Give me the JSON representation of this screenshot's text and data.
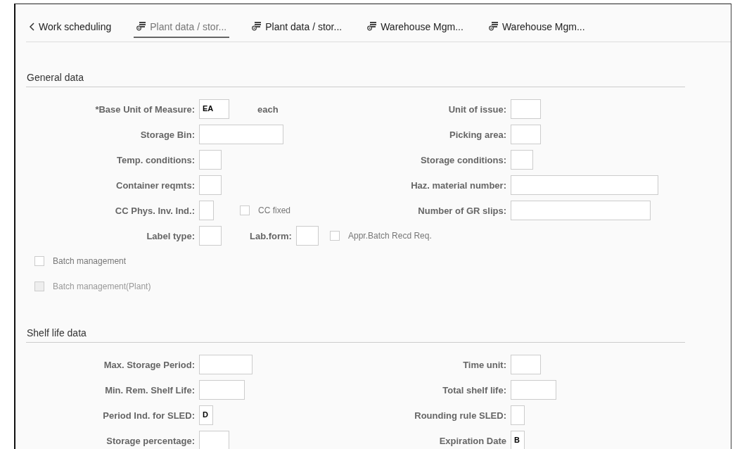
{
  "tabs": [
    {
      "label": "Work scheduling",
      "kind": "back",
      "selected": false
    },
    {
      "label": "Plant data / stor...",
      "kind": "view",
      "selected": true
    },
    {
      "label": "Plant data / stor...",
      "kind": "view",
      "selected": false
    },
    {
      "label": "Warehouse Mgm...",
      "kind": "view",
      "selected": false
    },
    {
      "label": "Warehouse Mgm...",
      "kind": "view",
      "selected": false
    }
  ],
  "sections": [
    {
      "title": "General data",
      "rows": [
        {
          "left": [
            {
              "kind": "field",
              "label": "*Base Unit of Measure:",
              "value": "EA"
            },
            {
              "kind": "text",
              "text": "each"
            }
          ],
          "right": [
            {
              "kind": "field",
              "label": "Unit of issue:"
            }
          ]
        },
        {
          "left": [
            {
              "kind": "field",
              "label": "Storage Bin:"
            }
          ],
          "right": [
            {
              "kind": "field",
              "label": "Picking area:"
            }
          ]
        },
        {
          "left": [
            {
              "kind": "field",
              "label": "Temp. conditions:"
            }
          ],
          "right": [
            {
              "kind": "field",
              "label": "Storage conditions:"
            }
          ]
        },
        {
          "left": [
            {
              "kind": "field",
              "label": "Container reqmts:"
            }
          ],
          "right": [
            {
              "kind": "field",
              "label": "Haz. material number:"
            }
          ]
        },
        {
          "left": [
            {
              "kind": "field",
              "label": "CC Phys. Inv. Ind.:"
            },
            {
              "kind": "checkbox",
              "label": "CC fixed",
              "checked": false,
              "disabled": false
            }
          ],
          "right": [
            {
              "kind": "field",
              "label": "Number of GR slips:"
            }
          ]
        },
        {
          "left": [
            {
              "kind": "field",
              "label": "Label type:"
            },
            {
              "kind": "field",
              "label": "Lab.form:"
            }
          ],
          "right": [
            {
              "kind": "checkbox",
              "label": "Appr.Batch Recd Req.",
              "checked": false,
              "disabled": false
            }
          ]
        },
        {
          "left": [
            {
              "kind": "checkbox",
              "label": "Batch management",
              "checked": false,
              "disabled": false
            }
          ],
          "right": []
        },
        {
          "left": [
            {
              "kind": "checkbox",
              "label": "Batch management(Plant)",
              "checked": false,
              "disabled": true
            }
          ],
          "right": []
        }
      ]
    },
    {
      "title": "Shelf life data",
      "rows": [
        {
          "left": [
            {
              "kind": "field",
              "label": "Max. Storage Period:"
            }
          ],
          "right": [
            {
              "kind": "field",
              "label": "Time unit:"
            }
          ]
        },
        {
          "left": [
            {
              "kind": "field",
              "label": "Min. Rem. Shelf Life:"
            }
          ],
          "right": [
            {
              "kind": "field",
              "label": "Total shelf life:"
            }
          ]
        },
        {
          "left": [
            {
              "kind": "field",
              "label": "Period Ind. for SLED:",
              "value": "D"
            }
          ],
          "right": [
            {
              "kind": "field",
              "label": "Rounding rule SLED:"
            }
          ]
        },
        {
          "left": [
            {
              "kind": "field",
              "label": "Storage percentage:"
            }
          ],
          "right": [
            {
              "kind": "field",
              "label": "Expiration Date",
              "value": "B"
            }
          ]
        }
      ]
    }
  ]
}
